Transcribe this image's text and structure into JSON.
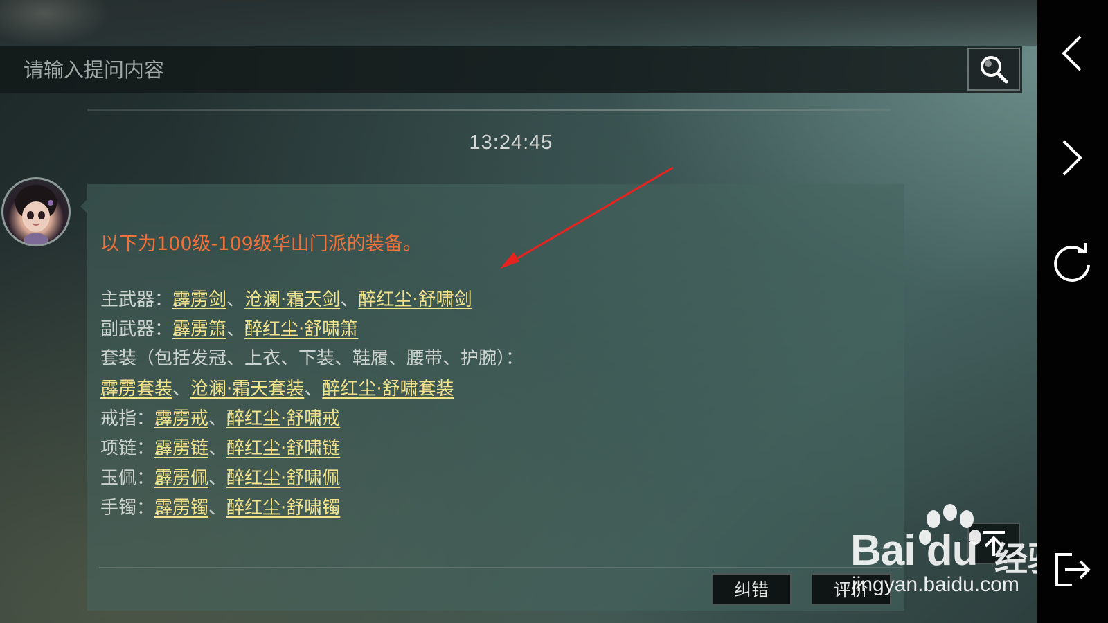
{
  "search": {
    "placeholder": "请输入提问内容"
  },
  "chat": {
    "timestamp": "13:24:45",
    "headline": "以下为100级-109级华山门派的装备。",
    "rows": [
      {
        "label": "主武器：",
        "links": [
          "霹雳剑",
          "沧澜·霜天剑",
          "醉红尘·舒啸剑"
        ]
      },
      {
        "label": "副武器：",
        "links": [
          "霹雳箫",
          "醉红尘·舒啸箫"
        ]
      },
      {
        "label": "套装（包括发冠、上衣、下装、鞋履、腰带、护腕）：",
        "links": []
      },
      {
        "label": "",
        "links": [
          "霹雳套装",
          "沧澜·霜天套装",
          "醉红尘·舒啸套装"
        ]
      },
      {
        "label": "戒指：",
        "links": [
          "霹雳戒",
          "醉红尘·舒啸戒"
        ]
      },
      {
        "label": "项链：",
        "links": [
          "霹雳链",
          "醉红尘·舒啸链"
        ]
      },
      {
        "label": "玉佩：",
        "links": [
          "霹雳佩",
          "醉红尘·舒啸佩"
        ]
      },
      {
        "label": "手镯：",
        "links": [
          "霹雳镯",
          "醉红尘·舒啸镯"
        ]
      }
    ],
    "separator": "、",
    "correct_label": "纠错",
    "rate_label": "评价"
  },
  "side_nav": {
    "icons": [
      "chevron-left-icon",
      "chevron-right-icon",
      "refresh-icon",
      "exit-icon"
    ]
  },
  "watermark": {
    "brand": "Bai du",
    "brand_suffix": "经验",
    "url": "jingyan.baidu.com"
  },
  "colors": {
    "headline": "#f0703a",
    "link": "#f2e38a",
    "body_text": "#cdd3cf",
    "annotation_arrow": "#e8231f"
  }
}
